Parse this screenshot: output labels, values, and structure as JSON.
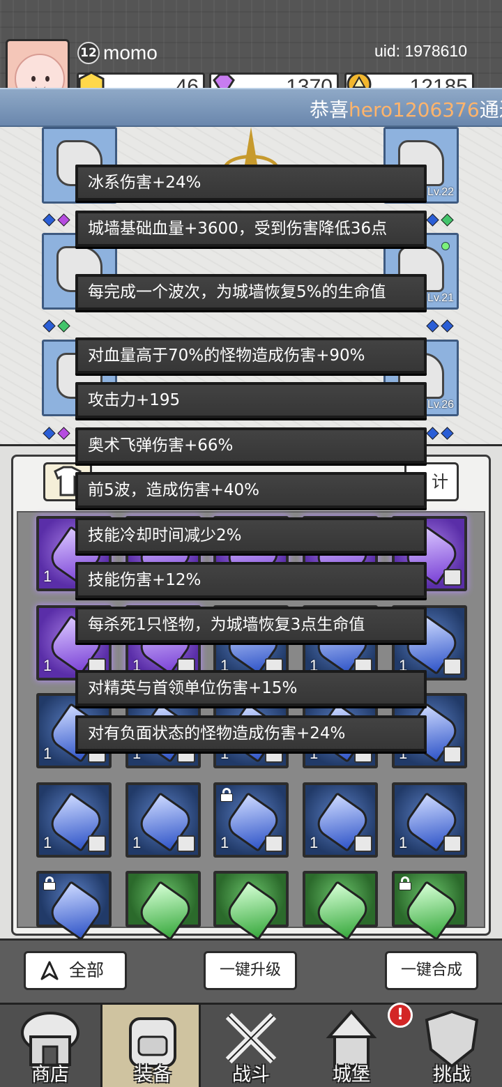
{
  "player": {
    "level": "12",
    "name": "momo",
    "uid": "uid: 1978610"
  },
  "currencies": {
    "gold_gem": "46",
    "diamond": "1370",
    "coin": "12185"
  },
  "marquee": {
    "prefix": "恭喜",
    "player": "hero1206376",
    "suffix": "通过"
  },
  "equipment": {
    "right_slots": [
      "Lv.22",
      "Lv.21",
      "Lv.26"
    ]
  },
  "inventory": {
    "stat_tab_label": "计",
    "slot_count": "1"
  },
  "tooltip_lines": [
    "冰系伤害+24%",
    "城墙基础血量+3600，受到伤害降低36点",
    "每完成一个波次，为城墙恢复5%的生命值",
    "对血量高于70%的怪物造成伤害+90%",
    "攻击力+195",
    "奥术飞弹伤害+66%",
    "前5波，造成伤害+40%",
    "技能冷却时间减少2%",
    "技能伤害+12%",
    "每杀死1只怪物，为城墙恢复3点生命值",
    "对精英与首领单位伤害+15%",
    "对有负面状态的怪物造成伤害+24%"
  ],
  "actions": {
    "all": "全部",
    "upgrade_all": "一键升级",
    "merge_all": "一键合成"
  },
  "nav": {
    "shop": "商店",
    "equipment": "装备",
    "battle": "战斗",
    "castle": "城堡",
    "challenge": "挑战",
    "castle_badge": "!"
  }
}
